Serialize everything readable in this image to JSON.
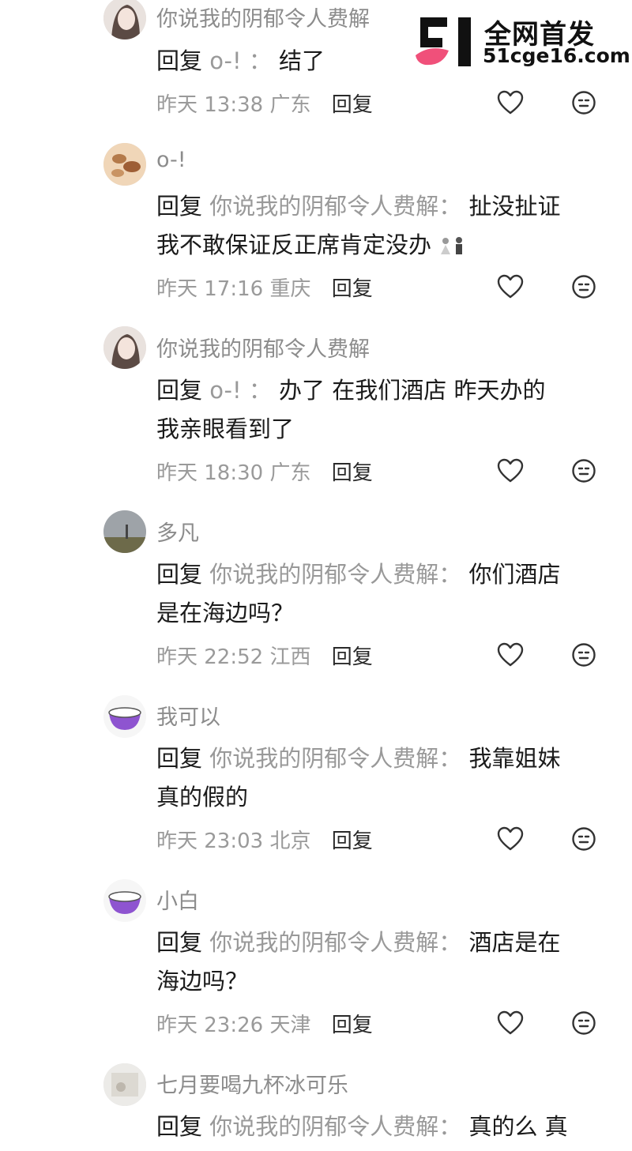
{
  "watermark": {
    "title": "全网首发",
    "url": "51cge16.com"
  },
  "comments": [
    {
      "username": "你说我的阴郁令人费解",
      "lines": [
        "__REPLY__o-! ：结了"
      ],
      "reply_label": "回复",
      "target": "o-! ：",
      "text": "结了",
      "text2": "",
      "time": "昨天 13:38 广东",
      "reply_btn": "回复"
    },
    {
      "username": "o-!",
      "reply_label": "回复",
      "target": "你说我的阴郁令人费解：",
      "text": "扯没扯证",
      "text2": "我不敢保证反正席肯定没办",
      "time": "昨天 17:16 重庆",
      "reply_btn": "回复"
    },
    {
      "username": "你说我的阴郁令人费解",
      "reply_label": "回复",
      "target": "o-! ：",
      "text": "办了 在我们酒店 昨天办的",
      "text2": "我亲眼看到了",
      "time": "昨天 18:30 广东",
      "reply_btn": "回复"
    },
    {
      "username": "多凡",
      "reply_label": "回复",
      "target": "你说我的阴郁令人费解：",
      "text": "你们酒店",
      "text2": "是在海边吗？",
      "time": "昨天 22:52 江西",
      "reply_btn": "回复"
    },
    {
      "username": "我可以",
      "reply_label": "回复",
      "target": "你说我的阴郁令人费解：",
      "text": "我靠姐妹",
      "text2": "真的假的",
      "time": "昨天 23:03 北京",
      "reply_btn": "回复"
    },
    {
      "username": "小白",
      "reply_label": "回复",
      "target": "你说我的阴郁令人费解：",
      "text": "酒店是在",
      "text2": "海边吗？",
      "time": "昨天 23:26 天津",
      "reply_btn": "回复"
    },
    {
      "username": "七月要喝九杯冰可乐",
      "reply_label": "回复",
      "target": "你说我的阴郁令人费解：",
      "text": "真的么 真",
      "text2": "",
      "time": "",
      "reply_btn": ""
    }
  ],
  "icons": {
    "like": "heart-icon",
    "dislike": "dislike-face-icon",
    "emoji_after_text_1": "bride-groom-emoji"
  },
  "colors": {
    "username": "#8c8c8c",
    "target": "#999999",
    "avatar_purple": "#8e54d0",
    "logo_pink": "#f0507a"
  }
}
